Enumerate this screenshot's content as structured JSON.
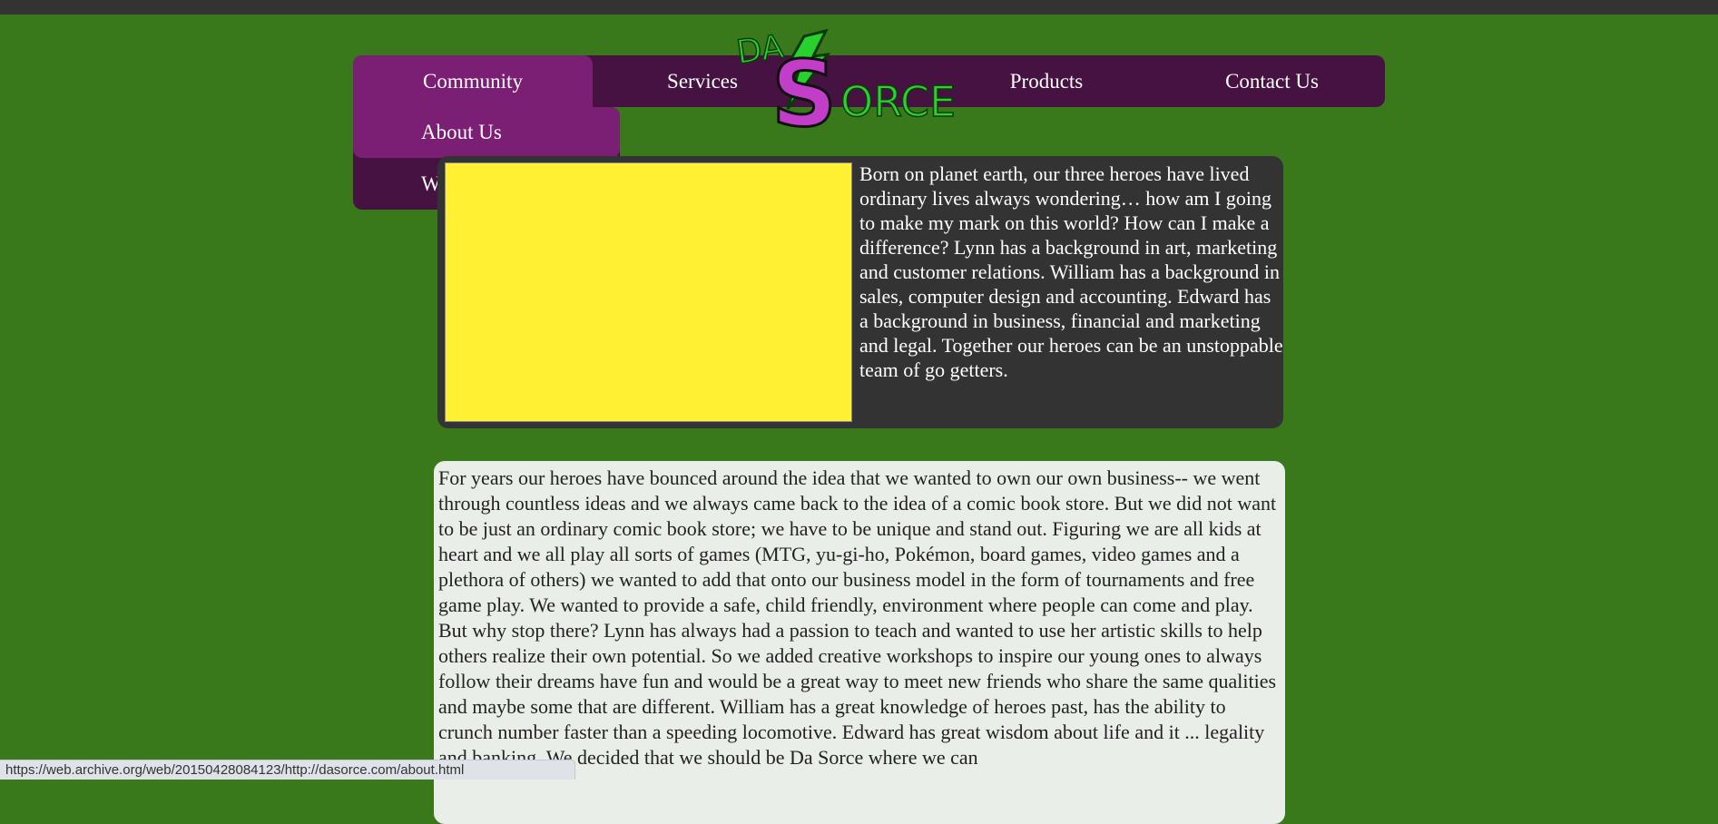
{
  "nav": {
    "items": [
      {
        "label": "Community"
      },
      {
        "label": "Services"
      },
      {
        "label": "Products"
      },
      {
        "label": "Contact Us"
      }
    ],
    "dropdown": [
      {
        "label": "About Us"
      },
      {
        "label": "Wall of Heroes"
      }
    ]
  },
  "logo": {
    "text_top": "DA",
    "text_main": "ORCE",
    "letter": "S",
    "icon": "lightning-bolt-icon"
  },
  "intro": {
    "text": "Born on planet earth, our three heroes have lived ordinary lives always wondering… how am I going to make my mark on this world? How can I make a difference? Lynn has a background in art, marketing and customer relations. William has a background in sales, computer design and accounting. Edward has a background in business, financial and marketing and legal. Together our heroes can be an unstoppable team of go getters."
  },
  "story": {
    "text": "For years our heroes have bounced around the idea that we wanted to own our own business-- we went through countless ideas and we always came back to the idea of a comic book store. But we did not want to be just an ordinary comic book store; we have to be unique and stand out. Figuring we are all kids at heart and we all play all sorts of games (MTG, yu-gi-ho, Pokémon, board games, video games and a plethora of others) we wanted to add that onto our business model in the form of tournaments and free game play. We wanted to provide a safe, child friendly, environment where people can come and play. But why stop there? Lynn has always had a passion to teach and wanted to use her artistic skills to help others realize their own potential. So we added creative workshops to inspire our young ones to always follow their dreams have fun and would be a great way to meet new friends who share the same qualities and maybe some that are different. William has a great knowledge of heroes past, has the ability to crunch number faster than a speeding locomotive. Edward has great wisdom about life and it ... legality and banking. We decided that we should be Da Sorce where we can"
  },
  "status": {
    "url": "https://web.archive.org/web/20150428084123/http://dasorce.com/about.html"
  },
  "colors": {
    "background": "#3a781c",
    "nav": "#451242",
    "nav_active": "#7a1f74",
    "placeholder": "#fff033",
    "panel_dark": "#333333"
  }
}
